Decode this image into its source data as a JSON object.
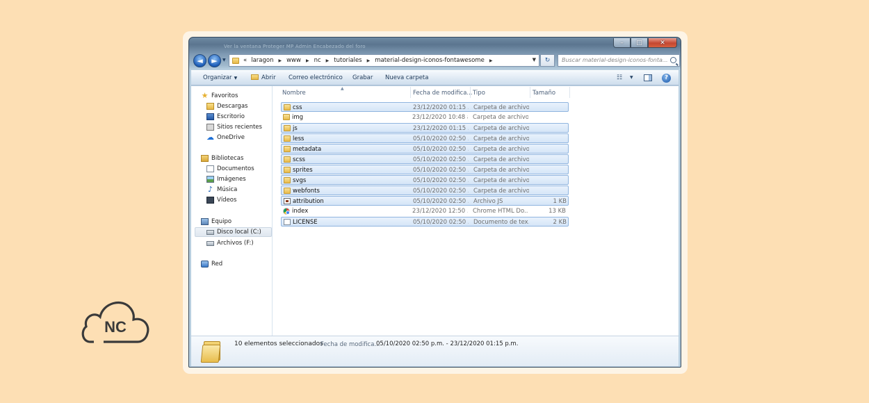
{
  "colors": {
    "background": "#fddfb4",
    "card": "#fdf4e6",
    "logo": "#3a3a3a",
    "selection": "#d5e5f7"
  },
  "logo": {
    "text": "NC"
  },
  "window": {
    "title_text": "Ver la ventana Proteger MP Admin Encabezado del foro"
  },
  "address": {
    "prefix": "«",
    "crumbs": [
      "laragon",
      "www",
      "nc",
      "tutoriales",
      "material-design-iconos-fontawesome"
    ],
    "search_placeholder": "Buscar material-design-iconos-fonta..."
  },
  "toolbar": {
    "organize": "Organizar",
    "open": "Abrir",
    "email": "Correo electrónico",
    "burn": "Grabar",
    "new_folder": "Nueva carpeta"
  },
  "nav": {
    "favorites": "Favoritos",
    "downloads": "Descargas",
    "desktop": "Escritorio",
    "recent": "Sitios recientes",
    "onedrive": "OneDrive",
    "libraries": "Bibliotecas",
    "documents": "Documentos",
    "images": "Imágenes",
    "music": "Música",
    "videos": "Vídeos",
    "computer": "Equipo",
    "disk_c": "Disco local (C:)",
    "disk_f": "Archivos (F:)",
    "network": "Red"
  },
  "columns": {
    "name": "Nombre",
    "date": "Fecha de modifica...",
    "type": "Tipo",
    "size": "Tamaño"
  },
  "files": [
    {
      "name": "css",
      "date": "23/12/2020 01:15 ...",
      "type": "Carpeta de archivos",
      "size": "",
      "icon": "folder-icon",
      "selected": true
    },
    {
      "name": "img",
      "date": "23/12/2020 10:48 a....",
      "type": "Carpeta de archivos",
      "size": "",
      "icon": "folder-icon",
      "selected": false
    },
    {
      "name": "js",
      "date": "23/12/2020 01:15 ...",
      "type": "Carpeta de archivos",
      "size": "",
      "icon": "folder-icon",
      "selected": true
    },
    {
      "name": "less",
      "date": "05/10/2020 02:50 ...",
      "type": "Carpeta de archivos",
      "size": "",
      "icon": "folder-icon",
      "selected": true
    },
    {
      "name": "metadata",
      "date": "05/10/2020 02:50 ...",
      "type": "Carpeta de archivos",
      "size": "",
      "icon": "folder-icon",
      "selected": true
    },
    {
      "name": "scss",
      "date": "05/10/2020 02:50 ...",
      "type": "Carpeta de archivos",
      "size": "",
      "icon": "folder-icon",
      "selected": true
    },
    {
      "name": "sprites",
      "date": "05/10/2020 02:50 ...",
      "type": "Carpeta de archivos",
      "size": "",
      "icon": "folder-icon",
      "selected": true
    },
    {
      "name": "svgs",
      "date": "05/10/2020 02:50 ...",
      "type": "Carpeta de archivos",
      "size": "",
      "icon": "folder-icon",
      "selected": true
    },
    {
      "name": "webfonts",
      "date": "05/10/2020 02:50 ...",
      "type": "Carpeta de archivos",
      "size": "",
      "icon": "folder-icon",
      "selected": true
    },
    {
      "name": "attribution",
      "date": "05/10/2020 02:50 ...",
      "type": "Archivo JS",
      "size": "1 KB",
      "icon": "js-file-icon",
      "selected": true
    },
    {
      "name": "index",
      "date": "23/12/2020 12:50 ...",
      "type": "Chrome HTML Do...",
      "size": "13 KB",
      "icon": "chrome-icon",
      "selected": false
    },
    {
      "name": "LICENSE",
      "date": "05/10/2020 02:50 ...",
      "type": "Documento de tex...",
      "size": "2 KB",
      "icon": "text-file-icon",
      "selected": true
    }
  ],
  "details": {
    "count": "10 elementos seleccionados",
    "label": "Fecha de modifica...",
    "value": "05/10/2020 02:50 p.m. - 23/12/2020 01:15 p.m."
  }
}
